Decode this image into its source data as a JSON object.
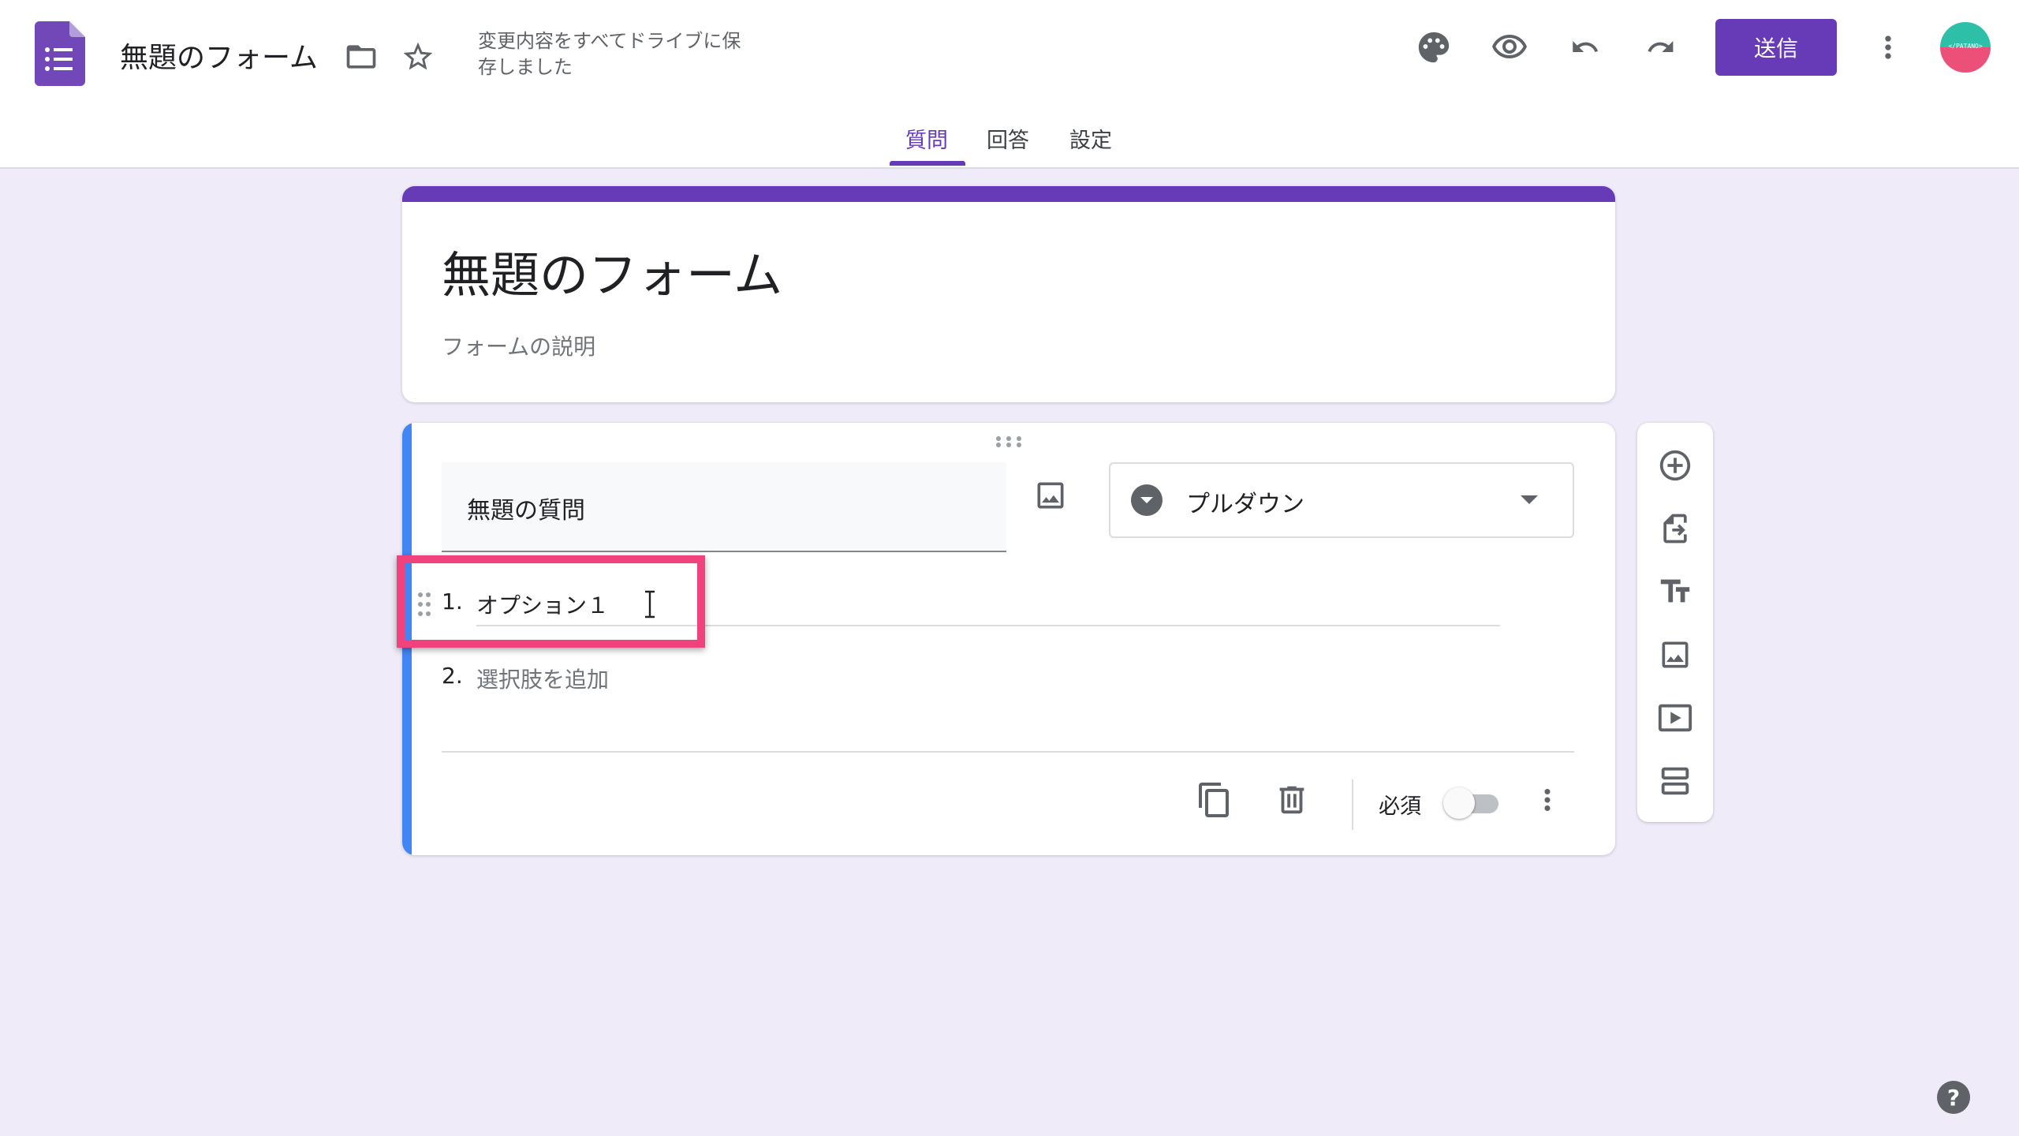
{
  "header": {
    "doc_title": "無題のフォーム",
    "save_status": "変更内容をすべてドライブに保存しました",
    "send_label": "送信",
    "avatar_text": "</PATANO>",
    "icons": [
      "forms-logo-icon",
      "folder-icon",
      "star-icon",
      "palette-icon",
      "eye-icon",
      "undo-icon",
      "redo-icon",
      "more-vert-icon"
    ]
  },
  "tabs": [
    {
      "label": "質問",
      "active": true
    },
    {
      "label": "回答",
      "active": false
    },
    {
      "label": "設定",
      "active": false
    }
  ],
  "form": {
    "title": "無題のフォーム",
    "description_placeholder": "フォームの説明"
  },
  "question": {
    "title": "無題の質問",
    "type_label": "プルダウン",
    "options": [
      {
        "number": "1.",
        "text": "オプション１"
      },
      {
        "number": "2.",
        "text": "選択肢を追加"
      }
    ],
    "required_label": "必須",
    "required": false
  },
  "side_toolbar": [
    "add-question-icon",
    "import-questions-icon",
    "add-title-icon",
    "add-image-icon",
    "add-video-icon",
    "add-section-icon"
  ],
  "colors": {
    "accent": "#673ab7",
    "background": "#f0ebf8",
    "active_bar": "#4285f4",
    "highlight": "#f0437d"
  }
}
